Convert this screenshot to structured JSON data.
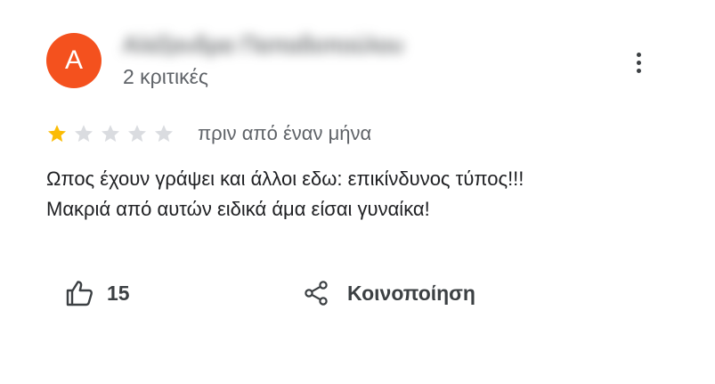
{
  "review": {
    "author": {
      "avatar_letter": "A",
      "avatar_color": "#f4511e",
      "name": "Αλέξανδρα Παπαδοπούλου",
      "name_blurred": true,
      "review_count": "2 κριτικές"
    },
    "menu_icon": "more-vert-icon",
    "rating": {
      "value": 1,
      "max": 5,
      "filled_color": "#fbbc04",
      "empty_color": "#dadce0"
    },
    "date": "πριν από έναν μήνα",
    "text_lines": [
      "Ωπος έχουν γράψει και άλλοι εδω: επικίνδυνος τύπος!!!",
      "Μακριά από αυτών ειδικά άμα είσαι γυναίκα!"
    ],
    "actions": {
      "like_icon": "thumb-up-icon",
      "like_count": "15",
      "share_icon": "share-icon",
      "share_label": "Κοινοποίηση"
    }
  }
}
